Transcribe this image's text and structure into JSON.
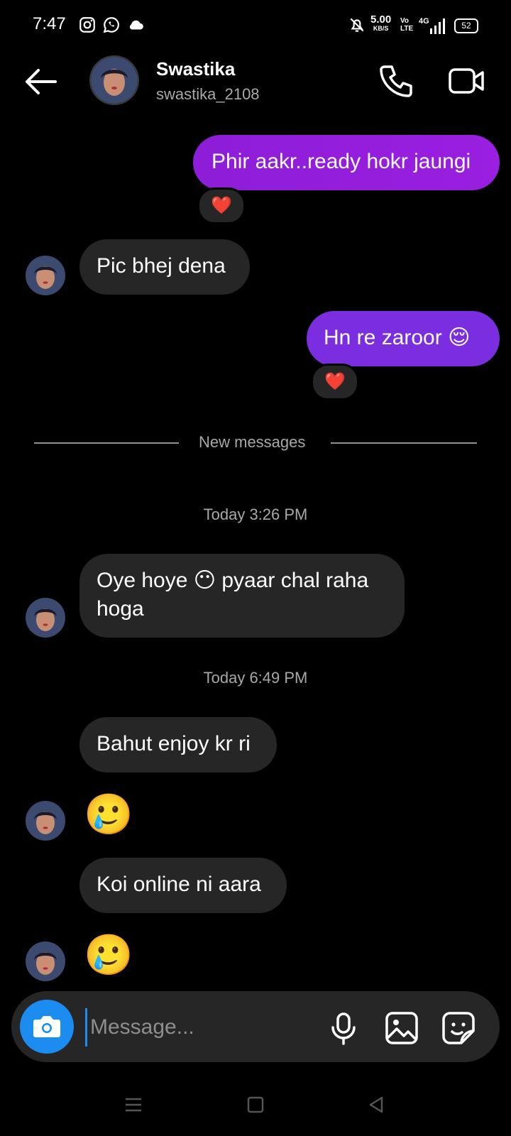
{
  "status_bar": {
    "time": "7:47",
    "speed": "5.00",
    "speed_unit": "KB/S",
    "volte": "Vo LTE",
    "network": "4G",
    "battery": "52"
  },
  "header": {
    "name": "Swastika",
    "username": "swastika_2108"
  },
  "messages": [
    {
      "type": "sent",
      "text": "Phir aakr..ready hokr jaungi",
      "reaction": "❤️"
    },
    {
      "type": "received",
      "text": "Pic bhej dena"
    },
    {
      "type": "sent",
      "text": "Hn re zaroor 😌",
      "reaction": "❤️"
    },
    {
      "type": "received",
      "text": "Oye hoye 😶 pyaar chal raha hoga"
    },
    {
      "type": "received",
      "text": "Bahut enjoy kr ri"
    },
    {
      "type": "received",
      "text": "🥲"
    },
    {
      "type": "received",
      "text": "Koi online ni aara"
    },
    {
      "type": "received",
      "text": "🥲"
    }
  ],
  "divider": {
    "label": "New messages"
  },
  "timestamps": [
    "Today 3:26 PM",
    "Today 6:49 PM"
  ],
  "composer": {
    "placeholder": "Message..."
  },
  "colors": {
    "accent": "#1c8cf0",
    "sent_bubble": "#8d1dd8",
    "received_bubble": "#262626"
  }
}
